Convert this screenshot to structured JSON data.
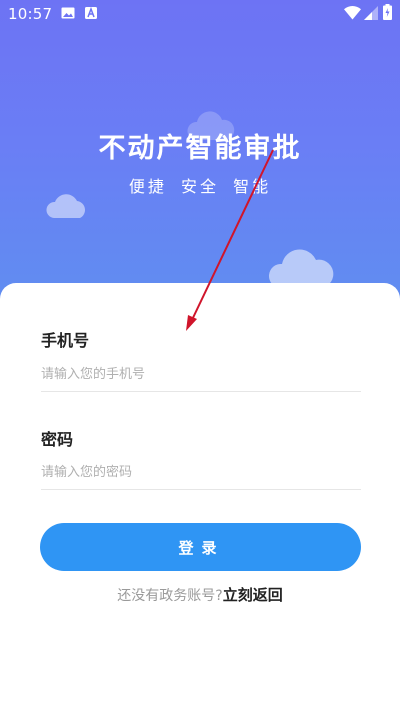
{
  "status_bar": {
    "time": "10:57",
    "icons": [
      "image-icon",
      "a-icon",
      "wifi-icon",
      "signal-icon",
      "battery-icon"
    ]
  },
  "header": {
    "title": "不动产智能审批",
    "subtitle": "便捷 安全 智能"
  },
  "form": {
    "phone": {
      "label": "手机号",
      "placeholder": "请输入您的手机号",
      "value": ""
    },
    "password": {
      "label": "密码",
      "placeholder": "请输入您的密码",
      "value": ""
    },
    "login_button": "登录"
  },
  "footer": {
    "prompt": "还没有政务账号?",
    "link": "立刻返回"
  },
  "colors": {
    "hero_top": "#6d73f4",
    "hero_bottom": "#5f8ff0",
    "button": "#2f95f4",
    "annotation_arrow": "#d0152b"
  }
}
